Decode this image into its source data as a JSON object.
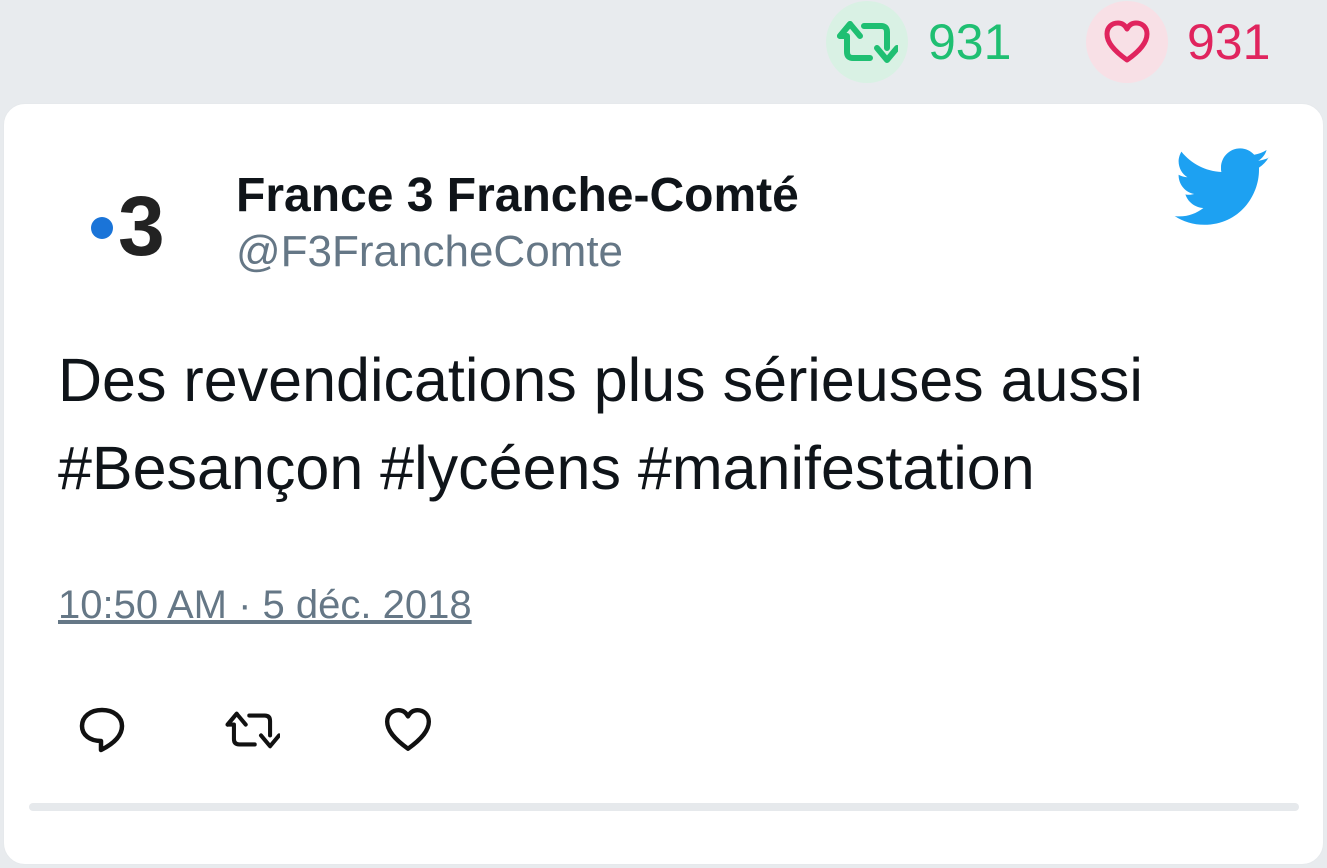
{
  "header_stats": {
    "retweets": "931",
    "likes": "931",
    "retweet_color": "#1fbf72",
    "like_color": "#e0245e"
  },
  "tweet": {
    "author": {
      "display_name": "France 3 Franche-Comté",
      "handle": "@F3FrancheComte",
      "avatar_text": "3",
      "avatar_icon": "france3-logo"
    },
    "text_line_1": "Des revendications plus sérieuses aussi",
    "text_line_2": "#Besançon #lycéens #manifestation",
    "timestamp": "10:50 AM · 5 déc. 2018",
    "platform_icon": "twitter-bird-icon",
    "actions": [
      "reply-icon",
      "retweet-icon",
      "like-icon"
    ]
  },
  "colors": {
    "twitter_blue": "#1da1f2",
    "secondary_text": "#657786",
    "background": "#e8ebee"
  }
}
